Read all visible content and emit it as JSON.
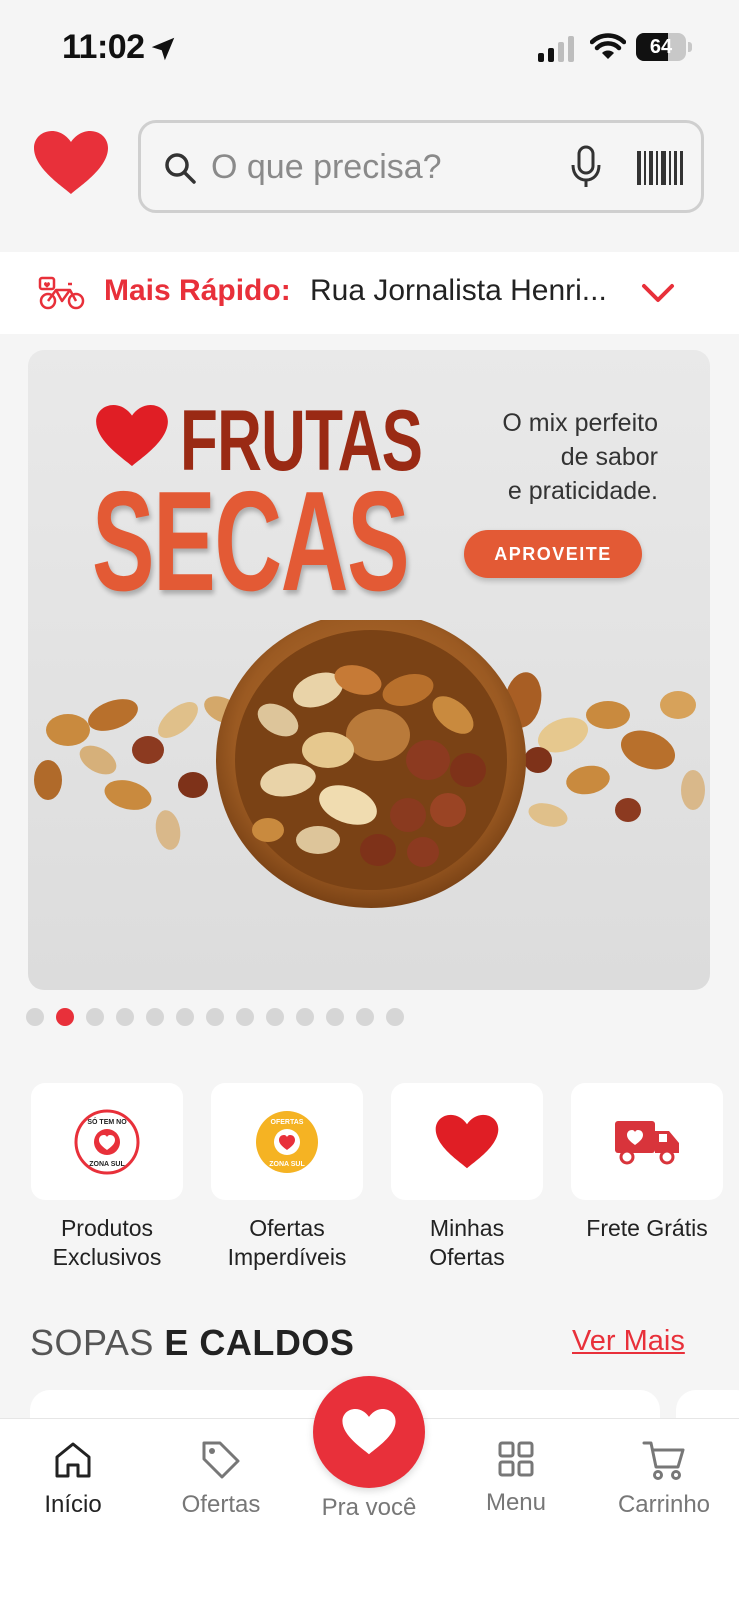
{
  "status_bar": {
    "time": "11:02",
    "battery": "64",
    "battery_level": 0.64
  },
  "search": {
    "placeholder": "O que precisa?"
  },
  "delivery": {
    "label": "Mais Rápido:",
    "address": "Rua Jornalista Henri..."
  },
  "banner": {
    "title_line1": "FRUTAS",
    "title_line2": "SECAS",
    "tagline_line1": "O mix perfeito",
    "tagline_line2": "de sabor",
    "tagline_line3": "e praticidade.",
    "cta": "APROVEITE"
  },
  "carousel": {
    "total": 13,
    "active_index": 1
  },
  "shortcuts": [
    {
      "line1": "Produtos",
      "line2": "Exclusivos",
      "badge": "SÓ TEM NO ZONA SUL"
    },
    {
      "line1": "Ofertas",
      "line2": "Imperdíveis",
      "badge": "OFERTAS ZONA SUL"
    },
    {
      "line1": "Minhas",
      "line2": "Ofertas"
    },
    {
      "line1": "Frete Grátis",
      "line2": ""
    }
  ],
  "section": {
    "title_light": "SOPAS",
    "title_bold": "E CALDOS",
    "see_more": "Ver Mais"
  },
  "nav": {
    "home": "Início",
    "offers": "Ofertas",
    "for_you": "Pra você",
    "menu": "Menu",
    "cart": "Carrinho"
  },
  "colors": {
    "brand_red": "#e8303a",
    "banner_orange": "#e35a35",
    "banner_brown": "#9a2a14"
  }
}
